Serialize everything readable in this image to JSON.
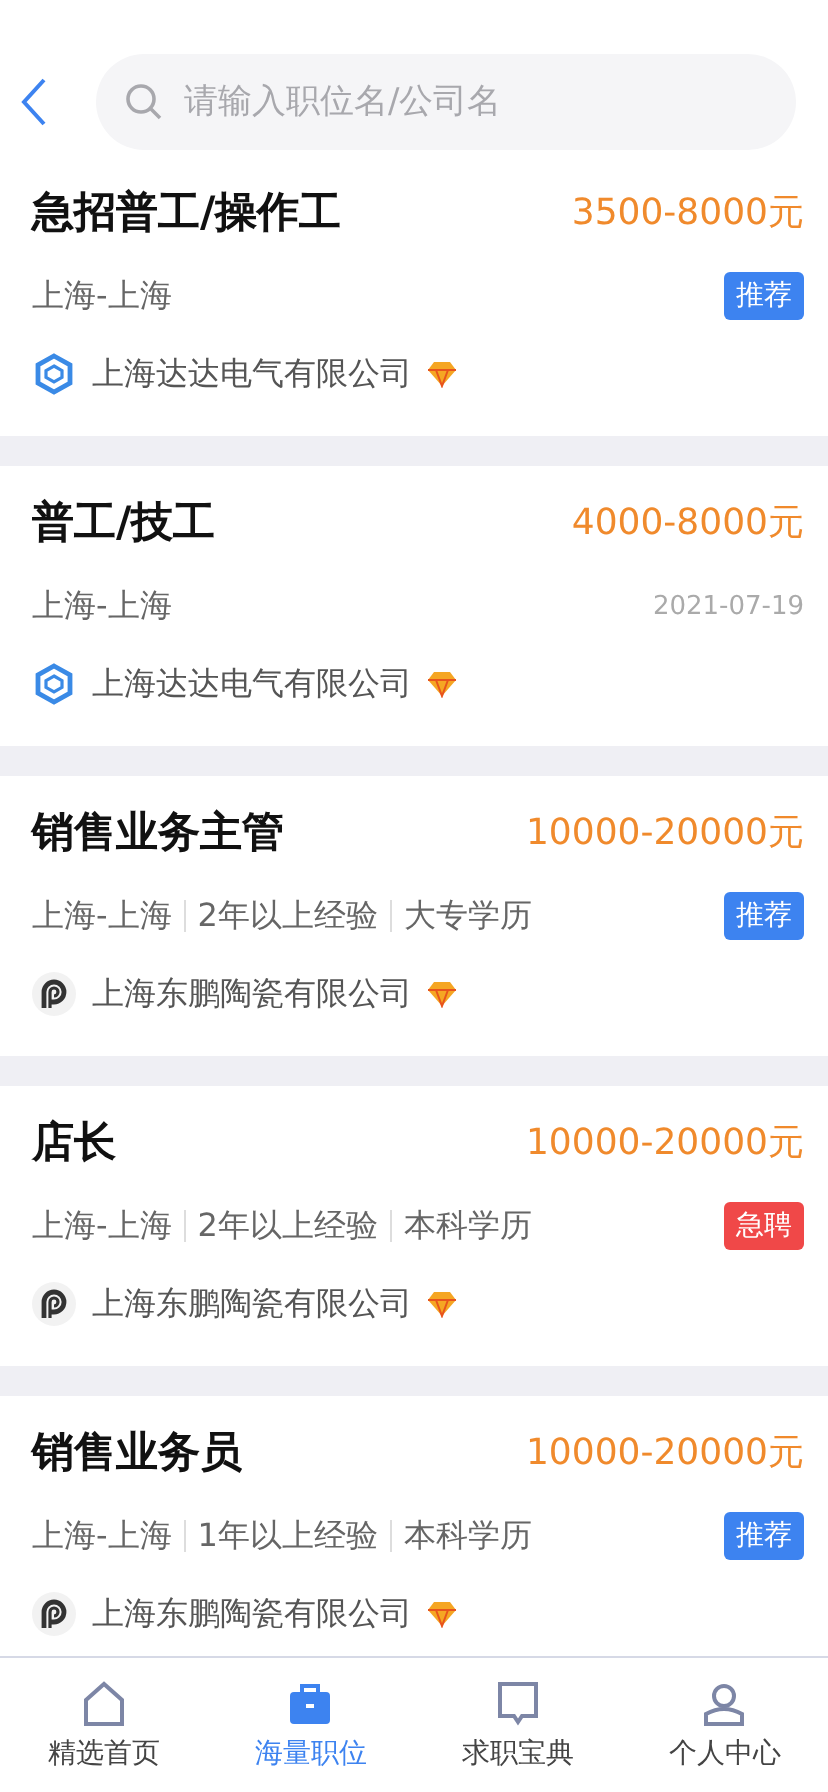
{
  "search": {
    "placeholder": "请输入职位名/公司名"
  },
  "jobs": [
    {
      "title": "急招普工/操作工",
      "salary": "3500-8000元",
      "meta": [
        "上海-上海"
      ],
      "tag": {
        "kind": "recommend",
        "text": "推荐"
      },
      "company": "上海达达电气有限公司",
      "kind": "hex"
    },
    {
      "title": "普工/技工",
      "salary": "4000-8000元",
      "meta": [
        "上海-上海"
      ],
      "date": "2021-07-19",
      "company": "上海达达电气有限公司",
      "kind": "hex"
    },
    {
      "title": "销售业务主管",
      "salary": "10000-20000元",
      "meta": [
        "上海-上海",
        "2年以上经验",
        "大专学历"
      ],
      "tag": {
        "kind": "recommend",
        "text": "推荐"
      },
      "company": "上海东鹏陶瓷有限公司",
      "kind": "p"
    },
    {
      "title": "店长",
      "salary": "10000-20000元",
      "meta": [
        "上海-上海",
        "2年以上经验",
        "本科学历"
      ],
      "tag": {
        "kind": "urgent",
        "text": "急聘"
      },
      "company": "上海东鹏陶瓷有限公司",
      "kind": "p"
    },
    {
      "title": "销售业务员",
      "salary": "10000-20000元",
      "meta": [
        "上海-上海",
        "1年以上经验",
        "本科学历"
      ],
      "tag": {
        "kind": "recommend",
        "text": "推荐"
      },
      "company": "上海东鹏陶瓷有限公司",
      "kind": "p"
    }
  ],
  "tabs": [
    {
      "label": "精选首页",
      "selected": false
    },
    {
      "label": "海量职位",
      "selected": true
    },
    {
      "label": "求职宝典",
      "selected": false
    },
    {
      "label": "个人中心",
      "selected": false
    }
  ]
}
